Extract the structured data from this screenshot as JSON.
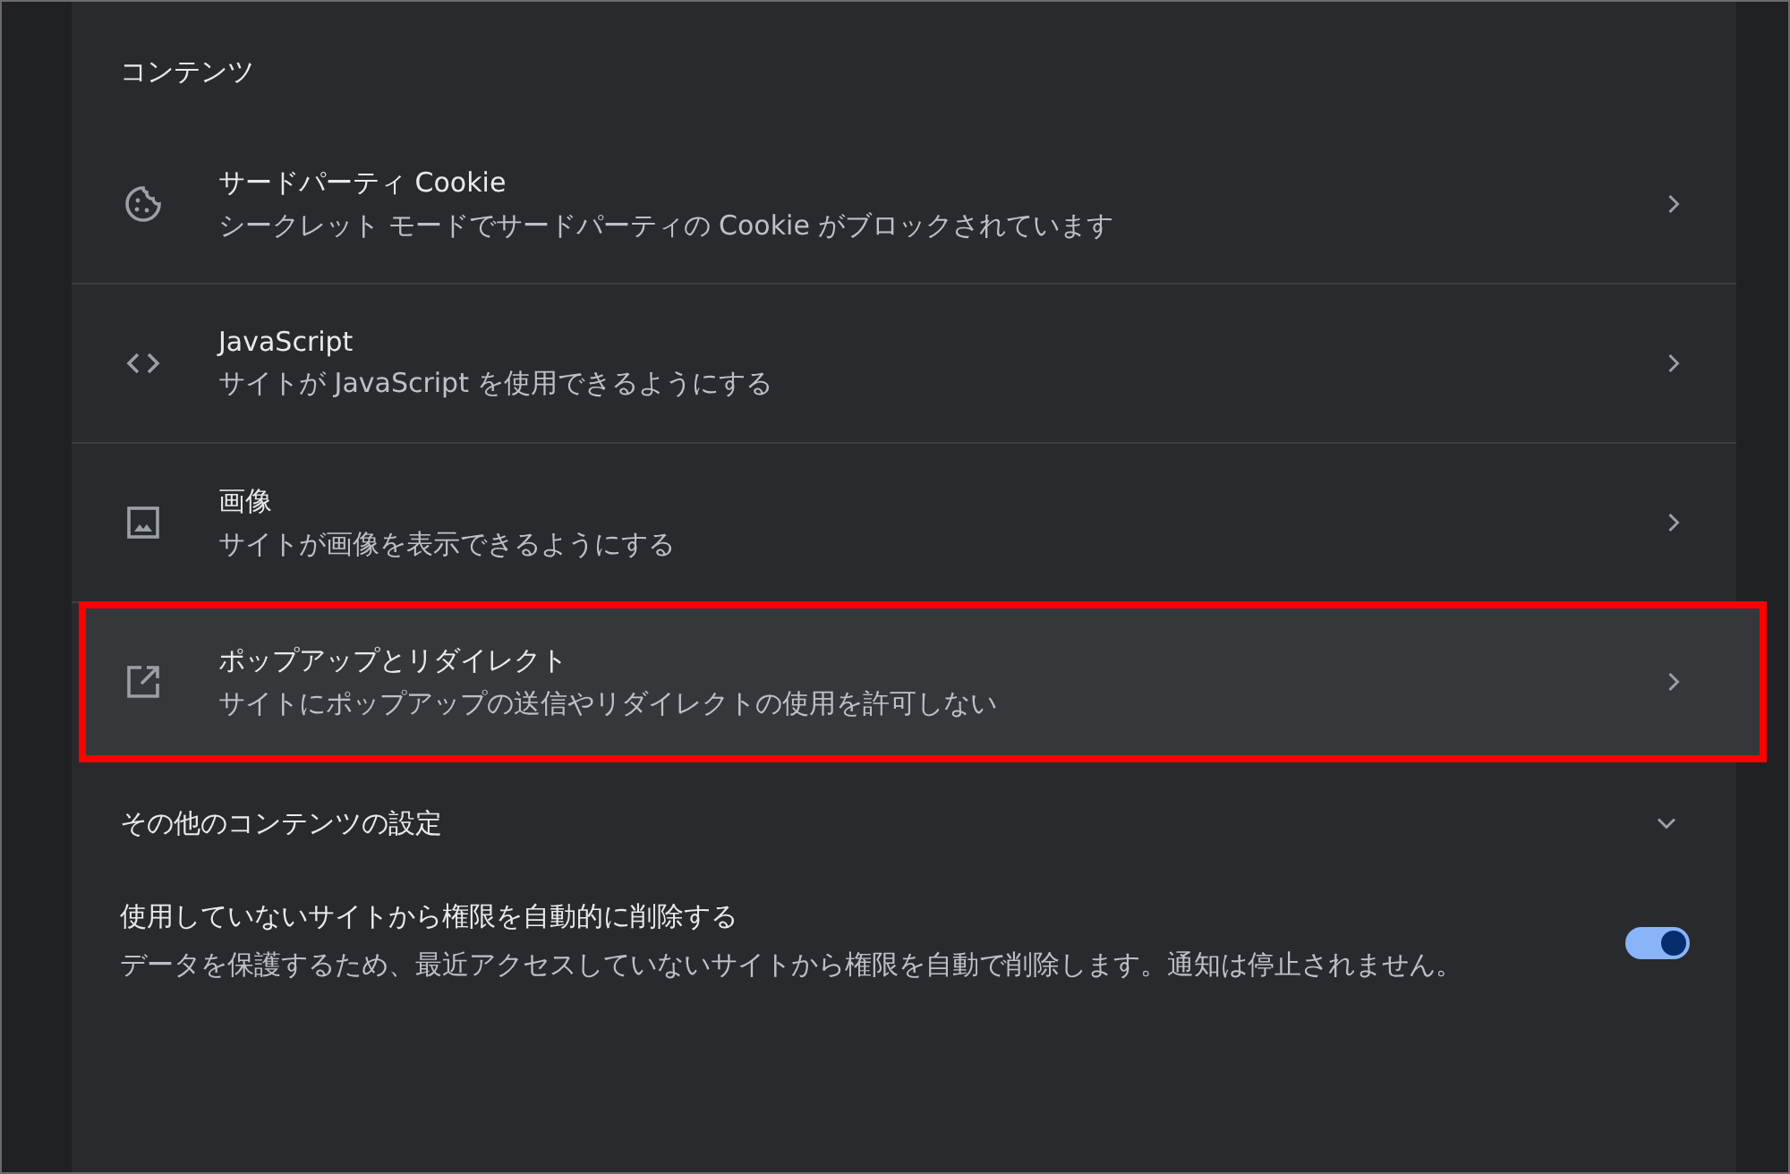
{
  "section": {
    "title": "コンテンツ"
  },
  "rows": [
    {
      "kind": "cookie",
      "title": "サードパーティ Cookie",
      "description": "シークレット モードでサードパーティの Cookie がブロックされています",
      "selected": false
    },
    {
      "kind": "code",
      "title": "JavaScript",
      "description": "サイトが JavaScript を使用できるようにする",
      "selected": false
    },
    {
      "kind": "image",
      "title": "画像",
      "description": "サイトが画像を表示できるようにする",
      "selected": false
    },
    {
      "kind": "popup",
      "title": "ポップアップとリダイレクト",
      "description": "サイトにポップアップの送信やリダイレクトの使用を許可しない",
      "selected": true
    }
  ],
  "more": {
    "label": "その他のコンテンツの設定",
    "expanded": false
  },
  "auto_remove": {
    "title": "使用していないサイトから権限を自動的に削除する",
    "description": "データを保護するため、最近アクセスしていないサイトから権限を自動で削除します。通知は停止されません。",
    "on": true
  }
}
